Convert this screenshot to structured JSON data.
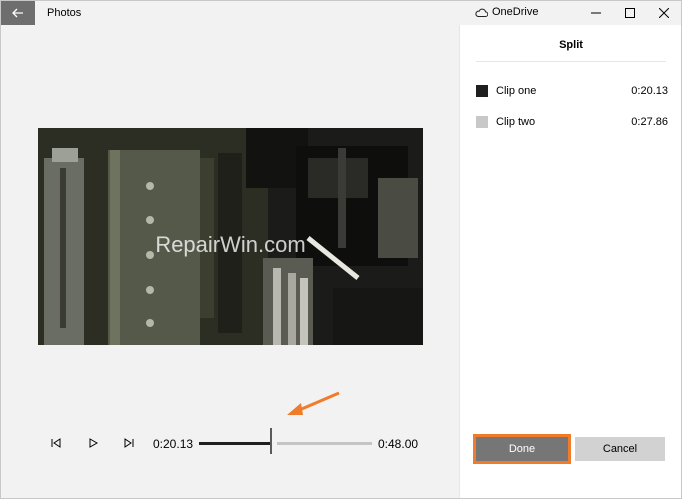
{
  "app": {
    "title": "Photos"
  },
  "titlebar": {
    "onedrive_label": "OneDrive"
  },
  "panel": {
    "title": "Split",
    "clips": [
      {
        "label": "Clip one",
        "time": "0:20.13",
        "color": "#1f1f1f"
      },
      {
        "label": "Clip two",
        "time": "0:27.86",
        "color": "#c8c8c8"
      }
    ],
    "done_label": "Done",
    "cancel_label": "Cancel"
  },
  "video": {
    "watermark": "RepairWin.com"
  },
  "player": {
    "current_time": "0:20.13",
    "total_time": "0:48.00",
    "progress": 0.42
  },
  "colors": {
    "accent": "#f07b2a",
    "done_bg": "#767676"
  },
  "icons": [
    "back-arrow-icon",
    "onedrive-cloud-icon",
    "minimize-icon",
    "maximize-icon",
    "close-icon",
    "previous-frame-icon",
    "play-icon",
    "next-frame-icon",
    "annotation-arrow-icon"
  ]
}
